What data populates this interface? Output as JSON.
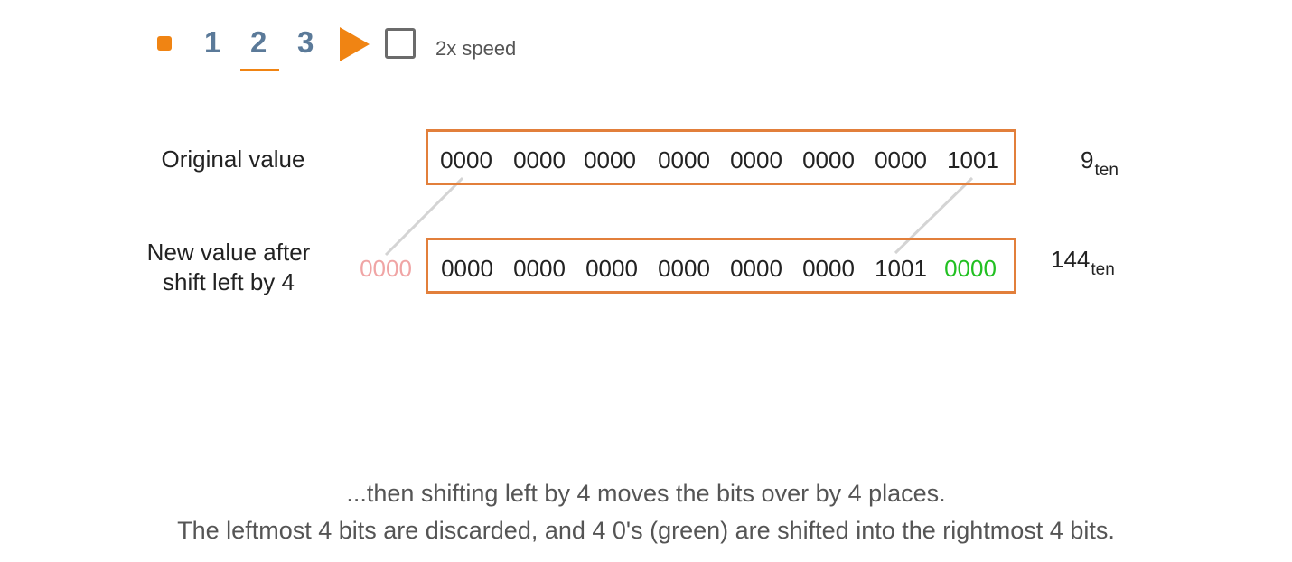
{
  "controls": {
    "steps": [
      "1",
      "2",
      "3"
    ],
    "active_step": "2",
    "speed_label": "2x speed",
    "accent_color": "#f08413",
    "step_color": "#5b7a99"
  },
  "diagram": {
    "original": {
      "label": "Original value",
      "nibbles": [
        "0000",
        "0000",
        "0000",
        "0000",
        "0000",
        "0000",
        "0000",
        "1001"
      ],
      "decimal_value": "9",
      "decimal_base": "ten"
    },
    "shifted": {
      "label_line1": "New value after",
      "label_line2": "shift left by 4",
      "discarded": "0000",
      "nibbles": [
        "0000",
        "0000",
        "0000",
        "0000",
        "0000",
        "0000",
        "1001",
        "0000"
      ],
      "decimal_value": "144",
      "decimal_base": "ten"
    },
    "box_color": "#e27f3b",
    "shifted_in_color": "#22c022",
    "discarded_color": "#f0a5a5"
  },
  "caption": {
    "line1": "...then shifting left by 4 moves the bits over by 4 places.",
    "line2": "The leftmost 4 bits are discarded, and 4 0's (green) are shifted into the rightmost 4 bits."
  }
}
